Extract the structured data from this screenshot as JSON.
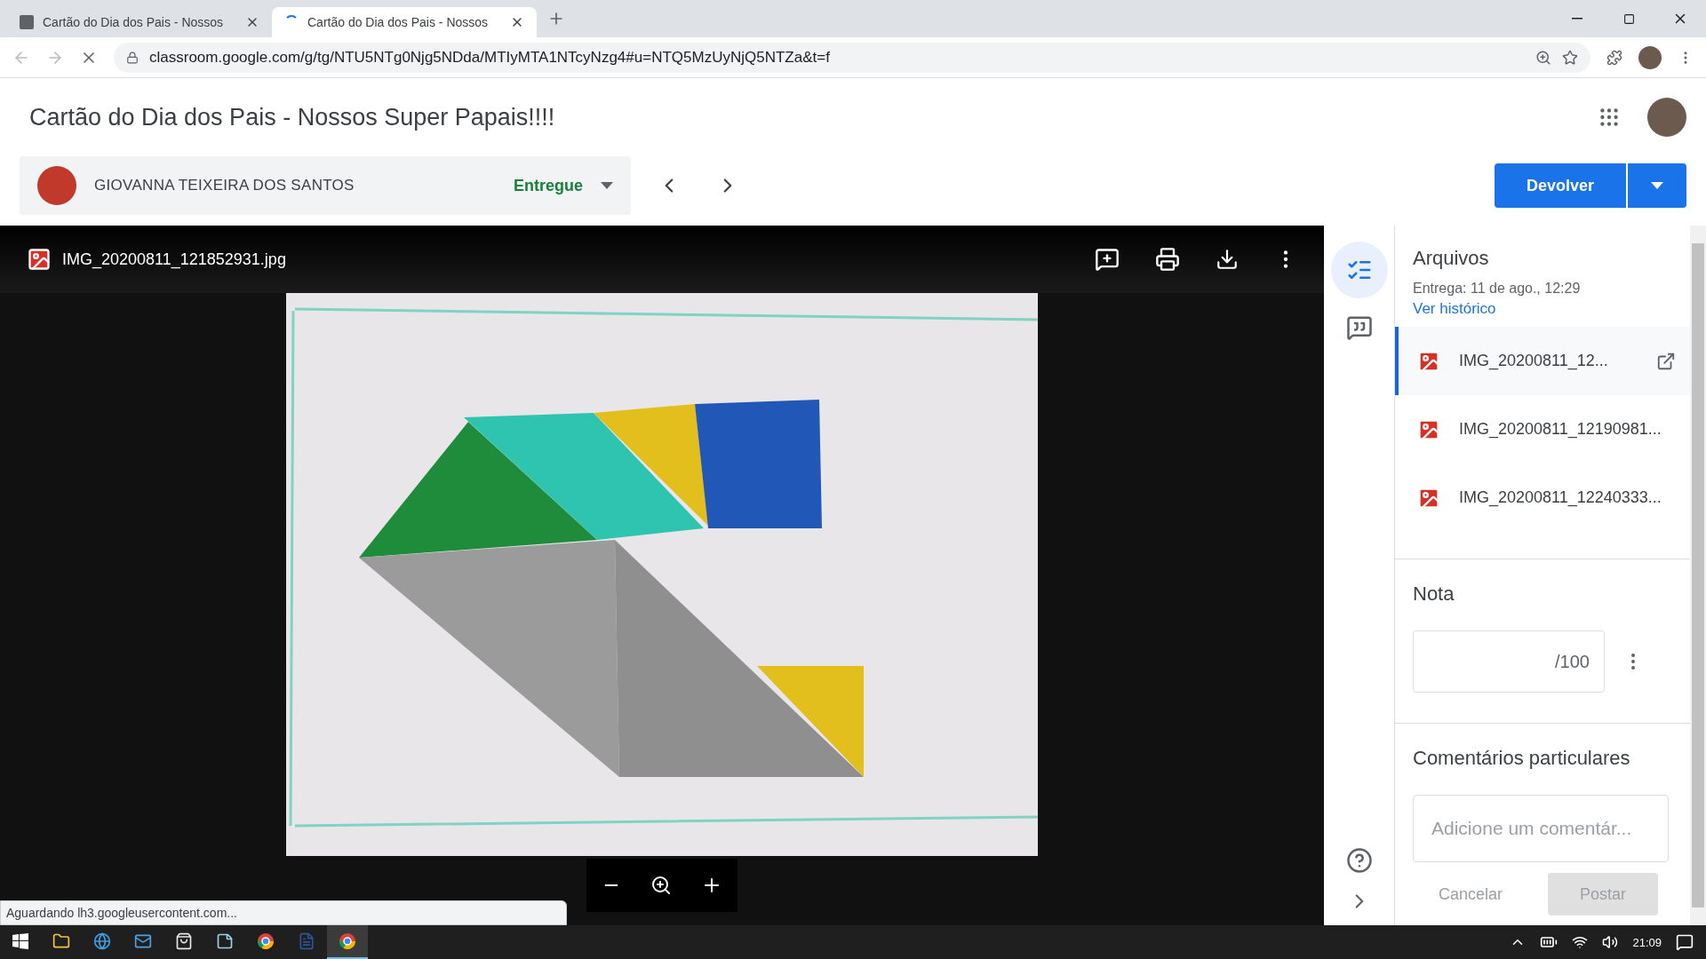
{
  "browser": {
    "tabs": [
      {
        "title": "Cartão do Dia dos Pais - Nossos",
        "selected": false
      },
      {
        "title": "Cartão do Dia dos Pais - Nossos",
        "selected": true
      }
    ],
    "url": "classroom.google.com/g/tg/NTU5NTg0Njg5NDda/MTIyMTA1NTcyNzg4#u=NTQ5MzUyNjQ5NTZa&t=f",
    "status_text": "Aguardando lh3.googleusercontent.com..."
  },
  "page": {
    "title": "Cartão do Dia dos Pais - Nossos Super Papais!!!!",
    "student": {
      "name": "GIOVANNA TEIXEIRA DOS SANTOS",
      "status": "Entregue"
    },
    "return_button": "Devolver"
  },
  "viewer": {
    "file_name": "IMG_20200811_121852931.jpg"
  },
  "panel": {
    "files_title": "Arquivos",
    "delivered": "Entrega: 11 de ago., 12:29",
    "history_link": "Ver histórico",
    "files": [
      {
        "name": "IMG_20200811_12...",
        "selected": true
      },
      {
        "name": "IMG_20200811_12190981...",
        "selected": false
      },
      {
        "name": "IMG_20200811_12240333...",
        "selected": false
      }
    ],
    "grade_title": "Nota",
    "grade_max": "/100",
    "comments_title": "Comentários particulares",
    "comment_placeholder": "Adicione um comentár...",
    "cancel": "Cancelar",
    "post": "Postar"
  },
  "taskbar": {
    "time": "21:09",
    "apps": [
      {
        "kind": "folder",
        "selected": false
      },
      {
        "kind": "edge",
        "selected": false
      },
      {
        "kind": "mail",
        "selected": false
      },
      {
        "kind": "store",
        "selected": false
      },
      {
        "kind": "notes",
        "selected": false
      },
      {
        "kind": "chrome",
        "selected": false
      },
      {
        "kind": "word",
        "selected": false
      },
      {
        "kind": "chrome",
        "selected": true
      }
    ]
  }
}
